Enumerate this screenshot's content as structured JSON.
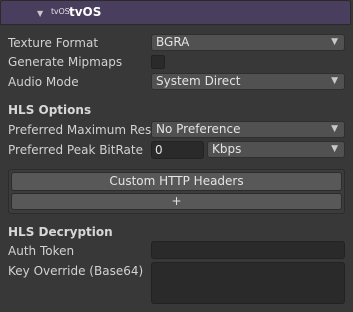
{
  "header": {
    "title": "tvOS",
    "logo_text": "tvOS"
  },
  "texture_format": {
    "label": "Texture Format",
    "value": "BGRA"
  },
  "generate_mipmaps": {
    "label": "Generate Mipmaps",
    "checked": false
  },
  "audio_mode": {
    "label": "Audio Mode",
    "value": "System Direct"
  },
  "hls_options": {
    "title": "HLS Options",
    "preferred_max_reso": {
      "label": "Preferred Maximum Reso",
      "value": "No Preference"
    },
    "preferred_peak_bitrate": {
      "label": "Preferred Peak BitRate",
      "value": "0",
      "unit": "Kbps"
    }
  },
  "custom_headers": {
    "label": "Custom HTTP Headers",
    "add_label": "+"
  },
  "hls_decryption": {
    "title": "HLS Decryption",
    "auth_token": {
      "label": "Auth Token",
      "value": ""
    },
    "key_override": {
      "label": "Key Override (Base64)",
      "value": ""
    }
  },
  "icons": {
    "foldout": "triangle-down-icon",
    "dropdown": "chevron-down-icon"
  }
}
